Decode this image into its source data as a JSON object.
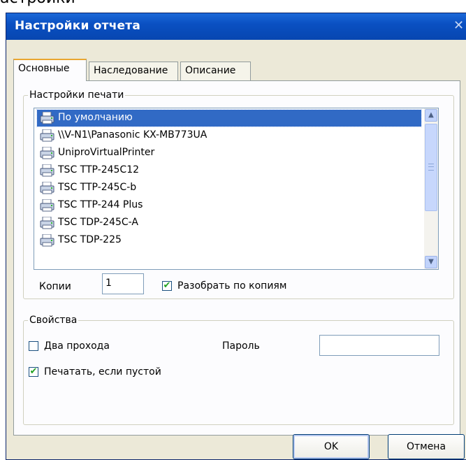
{
  "window": {
    "title_partial": "астройки",
    "title": "Настройки отчета"
  },
  "tabs": [
    {
      "label": "Основные",
      "active": true
    },
    {
      "label": "Наследование",
      "active": false
    },
    {
      "label": "Описание",
      "active": false
    }
  ],
  "print_settings": {
    "group_label": "Настройки печати",
    "printers": [
      {
        "name": "По умолчанию",
        "selected": true
      },
      {
        "name": "\\\\V-N1\\Panasonic KX-MB773UA",
        "selected": false
      },
      {
        "name": "UniproVirtualPrinter",
        "selected": false
      },
      {
        "name": "TSC TTP-245C12",
        "selected": false
      },
      {
        "name": "TSC TTP-245C-b",
        "selected": false
      },
      {
        "name": "TSC TTP-244 Plus",
        "selected": false
      },
      {
        "name": "TSC TDP-245C-A",
        "selected": false
      },
      {
        "name": "TSC TDP-225",
        "selected": false
      }
    ],
    "copies_label": "Копии",
    "copies_value": "1",
    "collate_label": "Разобрать по копиям",
    "collate_checked": true
  },
  "properties": {
    "group_label": "Свойства",
    "two_pass_label": "Два прохода",
    "two_pass_checked": false,
    "password_label": "Пароль",
    "password_value": "",
    "print_if_empty_label": "Печатать, если пустой",
    "print_if_empty_checked": true
  },
  "buttons": {
    "ok": "OK",
    "cancel": "Отмена"
  },
  "colors": {
    "titlebar": "#0a50c2",
    "selection": "#316ac5",
    "dialog_bg": "#ece9d8"
  }
}
